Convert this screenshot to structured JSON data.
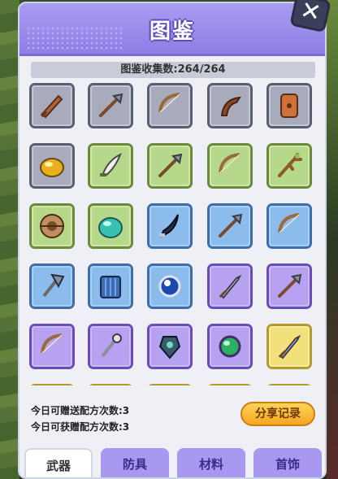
{
  "title": "图鉴",
  "close_label": "✕",
  "counter": "图鉴收集数:264/264",
  "info": {
    "gift_today": "今日可赠送配方次数:3",
    "receive_today": "今日可获赠配方次数:3"
  },
  "share_button": "分享记录",
  "tabs": [
    {
      "label": "武器",
      "active": true
    },
    {
      "label": "防具",
      "active": false
    },
    {
      "label": "材料",
      "active": false
    },
    {
      "label": "首饰",
      "active": false
    }
  ],
  "grid": {
    "columns": 5,
    "items": [
      {
        "icon": "wooden-sword-icon",
        "rarity": "grey"
      },
      {
        "icon": "spear-icon",
        "rarity": "grey"
      },
      {
        "icon": "bow-icon",
        "rarity": "grey"
      },
      {
        "icon": "boomerang-icon",
        "rarity": "grey"
      },
      {
        "icon": "shield-icon",
        "rarity": "grey"
      },
      {
        "icon": "gold-orb-icon",
        "rarity": "grey"
      },
      {
        "icon": "scimitar-icon",
        "rarity": "green"
      },
      {
        "icon": "spear-icon",
        "rarity": "green"
      },
      {
        "icon": "bow-icon",
        "rarity": "green"
      },
      {
        "icon": "branch-staff-icon",
        "rarity": "green"
      },
      {
        "icon": "round-shield-icon",
        "rarity": "green"
      },
      {
        "icon": "crystal-orb-icon",
        "rarity": "green"
      },
      {
        "icon": "curved-blade-icon",
        "rarity": "blue"
      },
      {
        "icon": "spear-icon",
        "rarity": "blue"
      },
      {
        "icon": "bow-icon",
        "rarity": "blue"
      },
      {
        "icon": "axe-icon",
        "rarity": "blue"
      },
      {
        "icon": "tower-shield-icon",
        "rarity": "blue"
      },
      {
        "icon": "blue-orb-icon",
        "rarity": "blue"
      },
      {
        "icon": "sword-icon",
        "rarity": "purple"
      },
      {
        "icon": "spear-icon",
        "rarity": "purple"
      },
      {
        "icon": "bow-icon",
        "rarity": "purple"
      },
      {
        "icon": "staff-icon",
        "rarity": "purple"
      },
      {
        "icon": "gem-shield-icon",
        "rarity": "purple"
      },
      {
        "icon": "green-orb-icon",
        "rarity": "purple"
      },
      {
        "icon": "sword-icon",
        "rarity": "yellow"
      },
      {
        "icon": "unknown-icon",
        "rarity": "yellow"
      },
      {
        "icon": "unknown-icon",
        "rarity": "yellow"
      },
      {
        "icon": "unknown-icon",
        "rarity": "yellow"
      },
      {
        "icon": "unknown-icon",
        "rarity": "yellow"
      },
      {
        "icon": "unknown-icon",
        "rarity": "yellow"
      }
    ]
  }
}
